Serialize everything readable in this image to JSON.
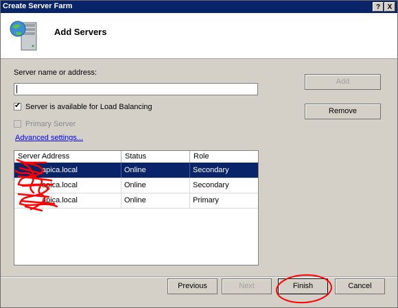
{
  "window": {
    "title": "Create Server Farm",
    "help_label": "?",
    "close_label": "X"
  },
  "header": {
    "title": "Add Servers",
    "icon": "server-globe-icon"
  },
  "form": {
    "server_label": "Server name or address:",
    "server_value": "",
    "load_balancing_label": "Server is available for Load Balancing",
    "load_balancing_checked": true,
    "primary_label": "Primary Server",
    "primary_checked": false,
    "advanced_link": "Advanced settings..."
  },
  "buttons": {
    "add": "Add",
    "remove": "Remove",
    "previous": "Previous",
    "next": "Next",
    "finish": "Finish",
    "cancel": "Cancel"
  },
  "table": {
    "columns": [
      "Server Address",
      "Status",
      "Role"
    ],
    "rows": [
      {
        "address": "apica.local",
        "status": "Online",
        "role": "Secondary",
        "selected": true
      },
      {
        "address": "apica.local",
        "status": "Online",
        "role": "Secondary",
        "selected": false
      },
      {
        "address": "apica.local",
        "status": "Online",
        "role": "Primary",
        "selected": false
      }
    ]
  },
  "colors": {
    "title_bar": "#0a246a",
    "selection": "#0a246a",
    "annotation": "#ff0000",
    "link": "#0000ff"
  }
}
